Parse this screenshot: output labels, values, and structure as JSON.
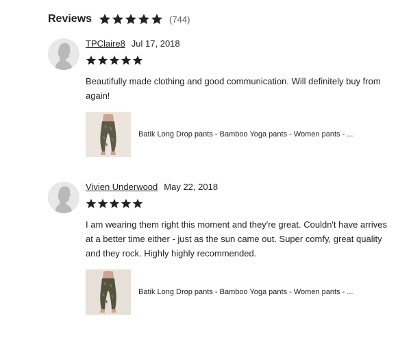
{
  "reviews_section": {
    "title": "Reviews",
    "rating_stars": 5,
    "count": "(744)"
  },
  "reviews": [
    {
      "reviewer": "TPClaire8",
      "date": "Jul 17, 2018",
      "rating": 5,
      "text": "Beautifully made clothing and good communication. Will definitely buy from again!",
      "product_title": "Batik Long Drop pants - Bamboo Yoga pants - Women pants - ..."
    },
    {
      "reviewer": "Vivien Underwood",
      "date": "May 22, 2018",
      "rating": 5,
      "text": "I am wearing them right this moment and they're great. Couldn't have arrives at a better time either - just as the sun came out. Super comfy, great quality and they rock. Highly highly recommended.",
      "product_title": "Batik Long Drop pants - Bamboo Yoga pants - Women pants - ..."
    }
  ],
  "colors": {
    "star": "#222222",
    "avatar_bg": "#e8e8e8",
    "avatar_figure": "#b9b9b9",
    "text": "#222222",
    "muted": "#595959"
  },
  "icons": {
    "star": "star-icon",
    "avatar": "default-avatar-icon",
    "product": "product-thumbnail"
  }
}
